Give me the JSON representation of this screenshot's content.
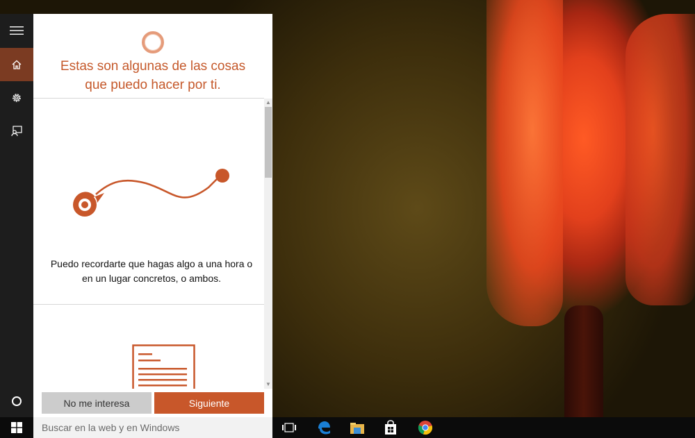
{
  "panel": {
    "heading_line1": "Estas son algunas de las cosas",
    "heading_line2": "que puedo hacer por ti.",
    "feature": {
      "text_line1": "Puedo recordarte que hagas algo a una hora o",
      "text_line2": "en un lugar concretos, o ambos."
    },
    "buttons": {
      "not_interested": "No me interesa",
      "next": "Siguiente"
    }
  },
  "rail": {
    "items": [
      {
        "icon": "menu-icon"
      },
      {
        "icon": "home-icon",
        "active": true
      },
      {
        "icon": "gear-icon"
      },
      {
        "icon": "feedback-icon"
      }
    ],
    "cortana_icon": "cortana-circle-icon"
  },
  "taskbar": {
    "search_placeholder": "Buscar en la web y en Windows",
    "pinned": [
      "task-view-icon",
      "edge-icon",
      "file-explorer-icon",
      "store-icon",
      "chrome-icon"
    ]
  },
  "colors": {
    "accent": "#c8572a",
    "accent_dark": "#7b3b22",
    "rail_bg": "#1d1d1d",
    "taskbar_bg": "#0b0b0b"
  }
}
